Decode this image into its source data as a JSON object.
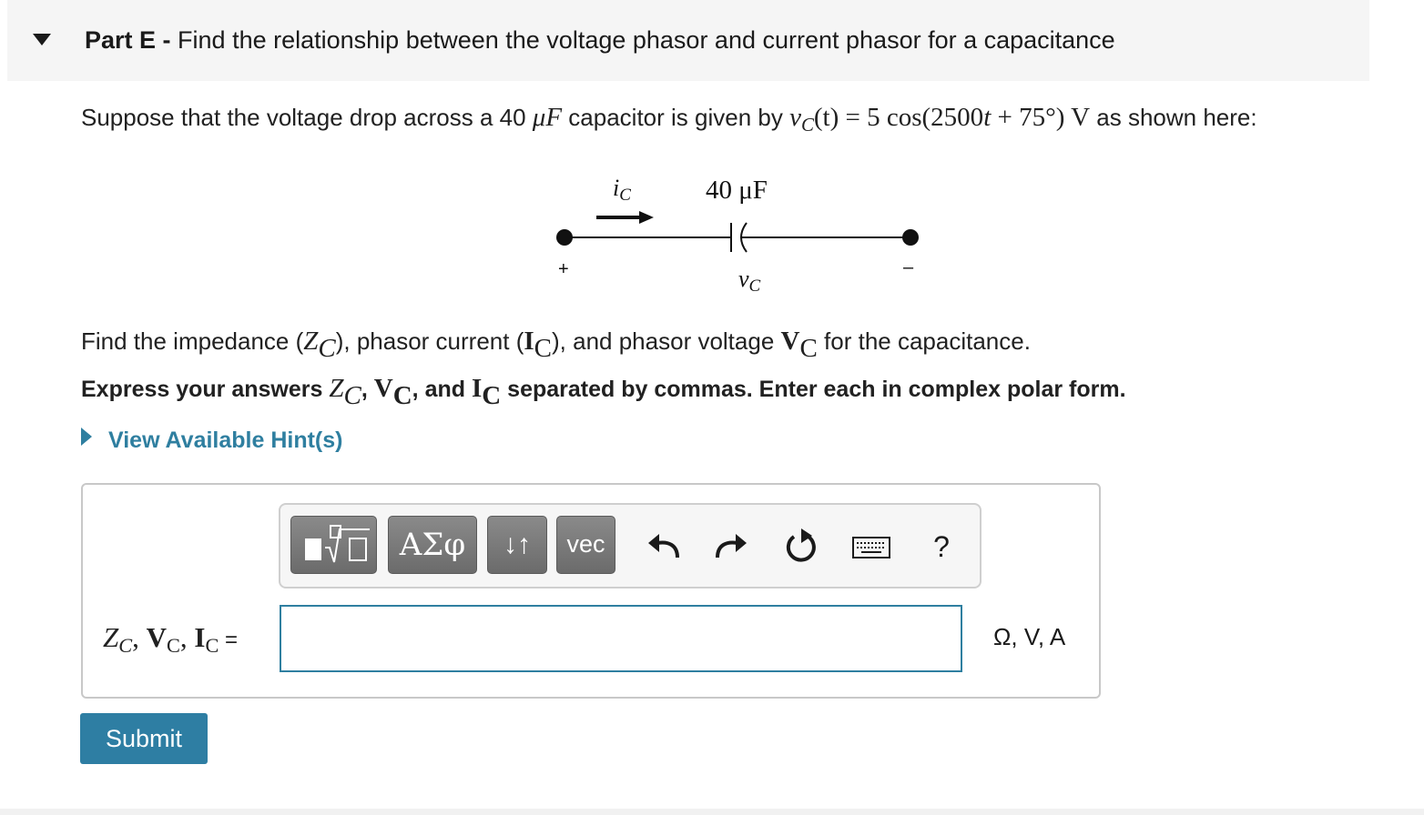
{
  "part": {
    "label": "Part E",
    "separator": " - ",
    "title": "Find the relationship between the voltage phasor and current phasor for a capacitance"
  },
  "problem": {
    "intro": "Suppose that the voltage drop across a 40 ",
    "unit": "μF",
    "middle": " capacitor is given by ",
    "v": "v",
    "v_sub": "C",
    "arg": "(t)",
    "rhs": " = 5 cos(2500",
    "t": "t",
    "rhs_end": " + 75°) V",
    "outro": " as shown here:"
  },
  "circuit": {
    "current_label": "i",
    "current_sub": "C",
    "cap_value": "40 μF",
    "voltage_label": "v",
    "voltage_sub": "C",
    "plus": "+",
    "minus": "–"
  },
  "instruction": {
    "p1": "Find the impedance (",
    "Z": "Z",
    "Z_sub": "C",
    "p2": "), phasor current (",
    "I": "I",
    "I_sub": "C",
    "p3": "), and phasor voltage ",
    "V": "V",
    "V_sub": "C",
    "p4": " for the capacitance."
  },
  "answer_instruction": {
    "p1": "Express your answers ",
    "Z": "Z",
    "Z_sub": "C",
    "c1": ", ",
    "V": "V",
    "V_sub": "C",
    "p2": ", and ",
    "I": "I",
    "I_sub": "C",
    "p3": " separated by commas. Enter each in complex polar form."
  },
  "hints_label": "View Available Hint(s)",
  "toolbar": {
    "symbols_label": "ΑΣφ",
    "updown_label": "↓↑",
    "vec_label": "vec",
    "undo_icon": "undo-icon",
    "redo_icon": "redo-icon",
    "reset_icon": "reset-icon",
    "keyboard_icon": "keyboard-icon",
    "help_label": "?"
  },
  "answer": {
    "Z": "Z",
    "Z_sub": "C",
    "sep1": ", ",
    "V": "V",
    "V_sub": "C",
    "sep2": ", ",
    "I": "I",
    "I_sub": "C",
    "eq": " =",
    "value": "",
    "units": "Ω, V, A"
  },
  "submit_label": "Submit",
  "colors": {
    "accent": "#2e7ea3",
    "header_bg": "#f5f5f5",
    "toolbar_button": "#7a7a7a"
  }
}
